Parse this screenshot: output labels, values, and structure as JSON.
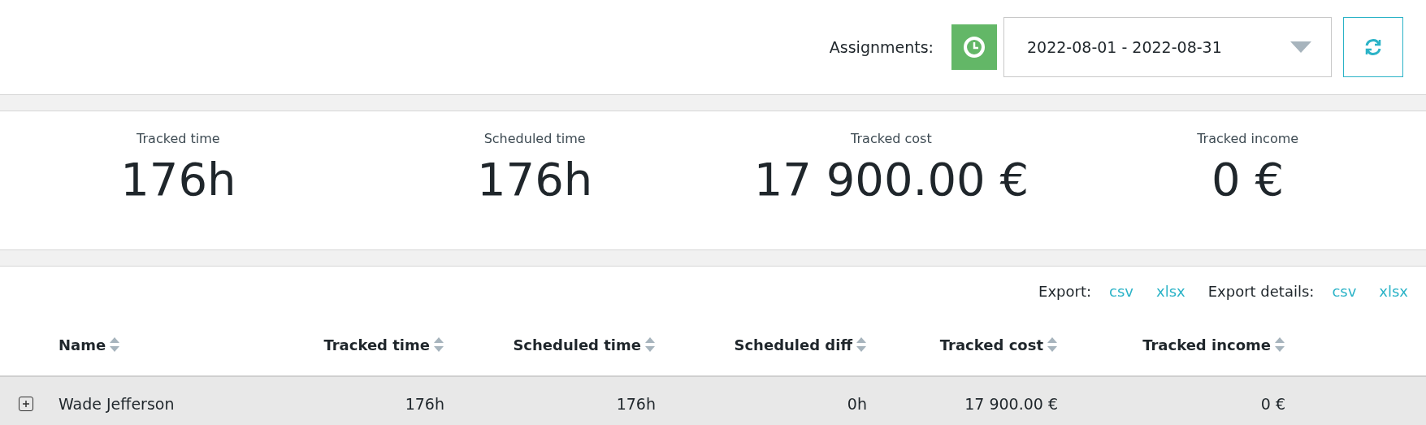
{
  "toolbar": {
    "label": "Assignments:",
    "date_range": "2022-08-01 - 2022-08-31"
  },
  "stats": [
    {
      "label": "Tracked time",
      "value": "176h"
    },
    {
      "label": "Scheduled time",
      "value": "176h"
    },
    {
      "label": "Tracked cost",
      "value": "17 900.00 €"
    },
    {
      "label": "Tracked income",
      "value": "0 €"
    }
  ],
  "export": {
    "label": "Export:",
    "links": [
      "csv",
      "xlsx"
    ],
    "details_label": "Export details:",
    "details_links": [
      "csv",
      "xlsx"
    ]
  },
  "table": {
    "columns": [
      "Name",
      "Tracked time",
      "Scheduled time",
      "Scheduled diff",
      "Tracked cost",
      "Tracked income"
    ],
    "rows": [
      {
        "expanded": false,
        "cells": [
          "Wade Jefferson",
          "176h",
          "176h",
          "0h",
          "17 900.00 €",
          "0 €"
        ]
      }
    ]
  }
}
